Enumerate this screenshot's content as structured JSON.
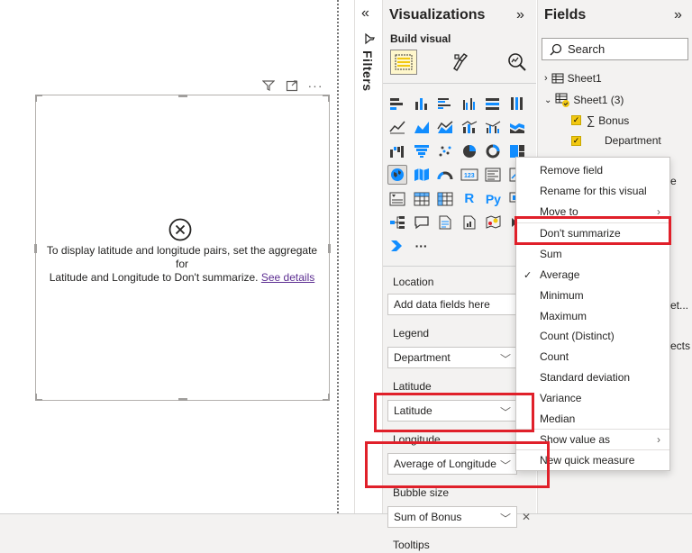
{
  "canvas": {
    "error_message_line1": "To display latitude and longitude pairs, set the aggregate for",
    "error_message_line2": "Latitude and Longitude to Don't summarize.",
    "see_details": "See details",
    "toolbar_icons": [
      "filter-icon",
      "focus-mode-icon",
      "more-options-icon"
    ]
  },
  "filters": {
    "label": "Filters"
  },
  "visualizations": {
    "title": "Visualizations",
    "build_visual_label": "Build visual",
    "more_label": "···",
    "wells": {
      "location": {
        "label": "Location",
        "placeholder": "Add data fields here"
      },
      "legend": {
        "label": "Legend",
        "value": "Department"
      },
      "latitude": {
        "label": "Latitude",
        "value": "Latitude"
      },
      "longitude": {
        "label": "Longitude",
        "value": "Average of Longitude"
      },
      "bubble_size": {
        "label": "Bubble size",
        "value": "Sum of Bonus"
      },
      "tooltips": {
        "label": "Tooltips"
      }
    }
  },
  "fields": {
    "title": "Fields",
    "search_placeholder": "Search",
    "tables": [
      {
        "name": "Sheet1"
      },
      {
        "name": "Sheet1 (3)"
      }
    ],
    "items": [
      {
        "name": "Bonus",
        "sigma": "∑"
      },
      {
        "name": "Department"
      }
    ],
    "partial": [
      "e",
      "et...",
      "ects"
    ]
  },
  "context_menu": {
    "items": [
      {
        "label": "Remove field"
      },
      {
        "label": "Rename for this visual"
      },
      {
        "label": "Move to"
      },
      {
        "label": "Don't summarize"
      },
      {
        "label": "Sum"
      },
      {
        "label": "Average",
        "checked": true
      },
      {
        "label": "Minimum"
      },
      {
        "label": "Maximum"
      },
      {
        "label": "Count (Distinct)"
      },
      {
        "label": "Count"
      },
      {
        "label": "Standard deviation"
      },
      {
        "label": "Variance"
      },
      {
        "label": "Median"
      },
      {
        "label": "Show value as"
      },
      {
        "label": "New quick measure"
      }
    ]
  },
  "colors": {
    "highlight": "#e0202a",
    "selected_tab": "#f2c811",
    "pane_bg": "#f3f2f1",
    "link": "#5c2d91"
  }
}
